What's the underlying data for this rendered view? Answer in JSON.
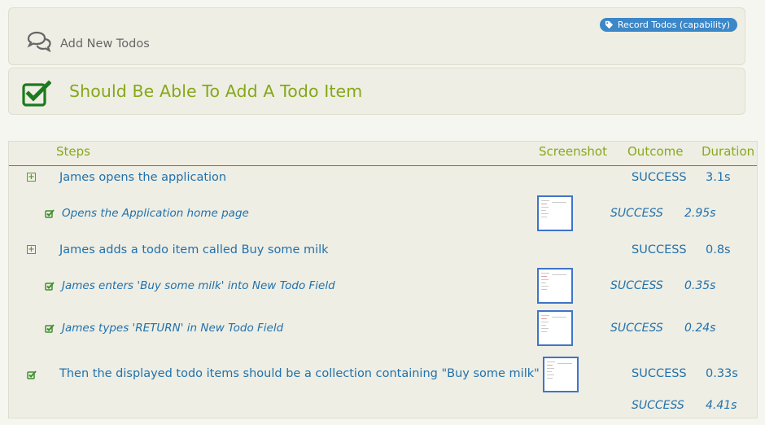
{
  "story": {
    "title": "Add New Todos",
    "icon": "speech-bubbles-icon",
    "tag": {
      "label": "Record Todos (capability)",
      "icon": "tag-icon",
      "color": "#3b87c8"
    }
  },
  "scenario": {
    "title": "Should Be Able To Add A Todo Item",
    "status_icon": "checkbox-checked-icon",
    "color": "#86a719"
  },
  "table": {
    "headers": {
      "steps": "Steps",
      "screenshot": "Screenshot",
      "outcome": "Outcome",
      "duration": "Duration"
    },
    "rows": [
      {
        "level": 0,
        "icon": "expand-icon",
        "text": "James opens the application",
        "screenshot": false,
        "outcome": "SUCCESS",
        "duration": "3.1s"
      },
      {
        "level": 1,
        "icon": "check-icon",
        "text": "Opens the Application home page",
        "screenshot": true,
        "outcome": "SUCCESS",
        "duration": "2.95s"
      },
      {
        "level": 0,
        "icon": "expand-icon",
        "text": "James adds a todo item called Buy some milk",
        "screenshot": false,
        "outcome": "SUCCESS",
        "duration": "0.8s"
      },
      {
        "level": 1,
        "icon": "check-icon",
        "text": "James enters 'Buy some milk' into New Todo Field",
        "screenshot": true,
        "outcome": "SUCCESS",
        "duration": "0.35s"
      },
      {
        "level": 1,
        "icon": "check-icon",
        "text": "James types 'RETURN' in New Todo Field",
        "screenshot": true,
        "outcome": "SUCCESS",
        "duration": "0.24s"
      },
      {
        "level": 0,
        "icon": "check-icon",
        "text": "Then the displayed todo items should be a collection containing \"Buy some milk\"",
        "screenshot": true,
        "outcome": "SUCCESS",
        "duration": "0.33s"
      }
    ],
    "total": {
      "outcome": "SUCCESS",
      "duration": "4.41s"
    }
  }
}
